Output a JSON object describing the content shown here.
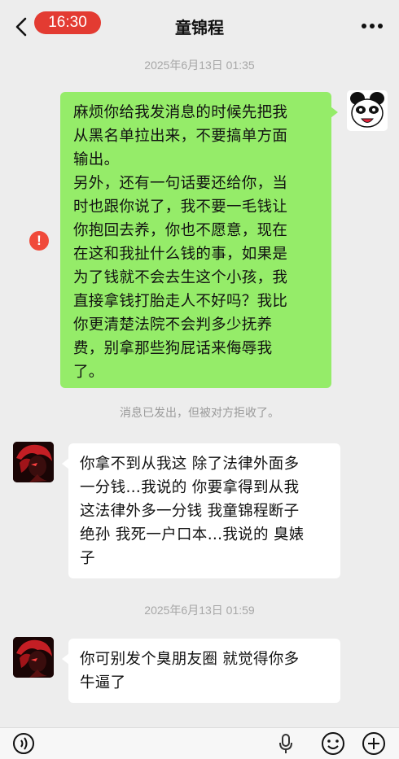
{
  "status_bar": {
    "time": "16:30"
  },
  "header": {
    "title": "童锦程"
  },
  "messages": [
    {
      "type": "timestamp",
      "text": "2025年6月13日 01:35"
    },
    {
      "type": "sent",
      "text": "麻烦你给我发消息的时候先把我\n从黑名单拉出来，不要搞单方面\n输出。\n另外，还有一句话要还给你，当\n时也跟你说了，我不要一毛钱让\n你抱回去养，你也不愿意，现在\n在这和我扯什么钱的事，如果是\n为了钱就不会去生这个小孩，我\n直接拿钱打胎走人不好吗？我比\n你更清楚法院不会判多少抚养\n费，别拿那些狗屁话来侮辱我\n了。",
      "status_icon": "!"
    },
    {
      "type": "system",
      "text": "消息已发出，但被对方拒收了。"
    },
    {
      "type": "received",
      "text": "你拿不到从我这 除了法律外面多\n一分钱…我说的 你要拿得到从我\n这法律外多一分钱 我童锦程断子\n绝孙 我死一户口本…我说的 臭婊\n子"
    },
    {
      "type": "timestamp",
      "text": "2025年6月13日 01:59"
    },
    {
      "type": "received",
      "text": "你可别发个臭朋友圈 就觉得你多\n牛逼了"
    }
  ],
  "colors": {
    "background": "#ededed",
    "sent_bubble": "#95ec69",
    "received_bubble": "#ffffff",
    "time_pill": "#e33b32",
    "error_icon": "#f04a3a"
  },
  "icons": {
    "back": "chevron-left-icon",
    "more": "more-dots-icon",
    "voice": "voice-icon",
    "mic": "microphone-icon",
    "emoji": "emoji-icon",
    "plus": "plus-icon"
  }
}
